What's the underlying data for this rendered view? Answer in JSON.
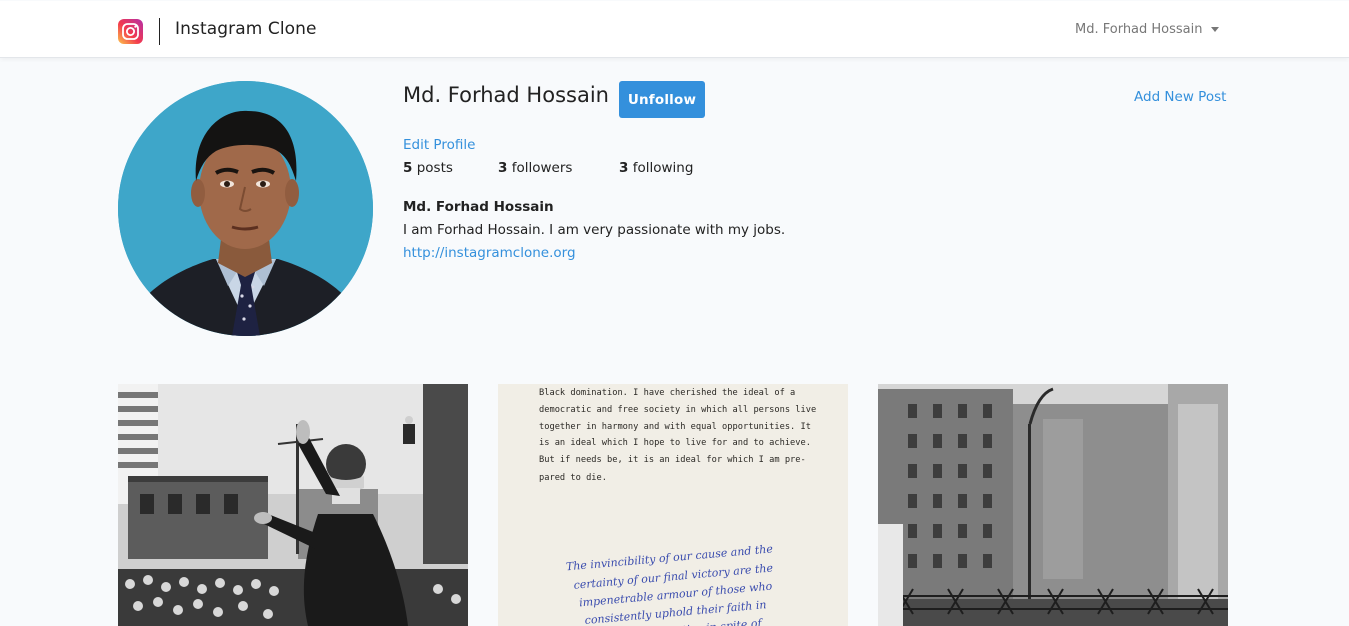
{
  "navbar": {
    "brand_title": "Instagram Clone",
    "user_menu_label": "Md. Forhad Hossain",
    "icons": {
      "brand": "instagram-logo-icon",
      "dropdown": "caret-down-icon"
    }
  },
  "profile": {
    "username": "Md. Forhad Hossain",
    "follow_button_label": "Unfollow",
    "add_post_label": "Add New Post",
    "edit_profile_label": "Edit Profile",
    "stats": {
      "posts_count": "5",
      "posts_label": "posts",
      "followers_count": "3",
      "followers_label": "followers",
      "following_count": "3",
      "following_label": "following"
    },
    "bio": {
      "name": "Md. Forhad Hossain",
      "description": "I am Forhad Hossain. I am very passionate with my jobs.",
      "url": "http://instagramclone.org"
    }
  },
  "posts": [
    {
      "subject": "black-and-white photo of a man speaking to a crowd"
    },
    {
      "subject": "typed letter with handwritten notes",
      "typed_lines": [
        "Black domination.  I have cherished the ideal of a",
        "democratic and free society in which all persons live",
        "together in harmony and with equal opportunities.  It",
        "is an ideal which I hope to live for and to achieve.",
        "But if needs be, it is an ideal for which I am pre-",
        "pared to die."
      ],
      "handwritten_lines": [
        "The invincibility of our cause and the",
        "certainty of our final victory are the",
        "impenetrable armour of those who",
        "consistently uphold their faith in",
        "freedom and justice in spite of"
      ]
    },
    {
      "subject": "black-and-white photo of buildings behind barbed wire"
    }
  ],
  "colors": {
    "accent": "#3490dc",
    "page_background": "#f8fafc",
    "avatar_background": "#3ea6c9"
  }
}
